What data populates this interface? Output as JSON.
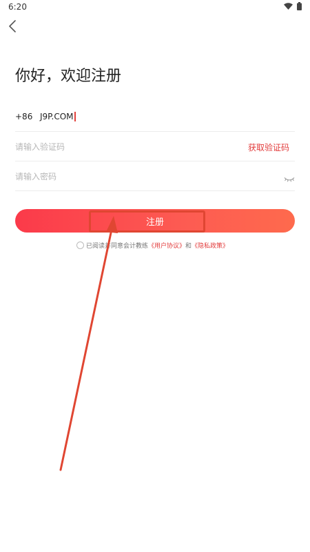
{
  "status_bar": {
    "time": "6:20",
    "icons": [
      "wifi-icon",
      "battery-icon"
    ]
  },
  "header": {
    "back_icon": "chevron-left-icon"
  },
  "title": "你好，欢迎注册",
  "form": {
    "country_code": "+86",
    "phone_value": "J9P.COM",
    "code_placeholder": "请输入验证码",
    "get_code_label": "获取验证码",
    "password_placeholder": "请输入密码",
    "password_toggle_icon": "eye-closed-icon"
  },
  "register_button": {
    "label": "注册"
  },
  "agreement": {
    "prefix": "已阅读并同意会计教练",
    "terms_link": "《用户协议》",
    "conjunction": "和",
    "privacy_link": "《隐私政策》"
  },
  "colors": {
    "accent": "#e23c3c",
    "button_gradient_start": "#fb3a4a",
    "button_gradient_end": "#fe6a4d",
    "annotation": "#e04632"
  }
}
